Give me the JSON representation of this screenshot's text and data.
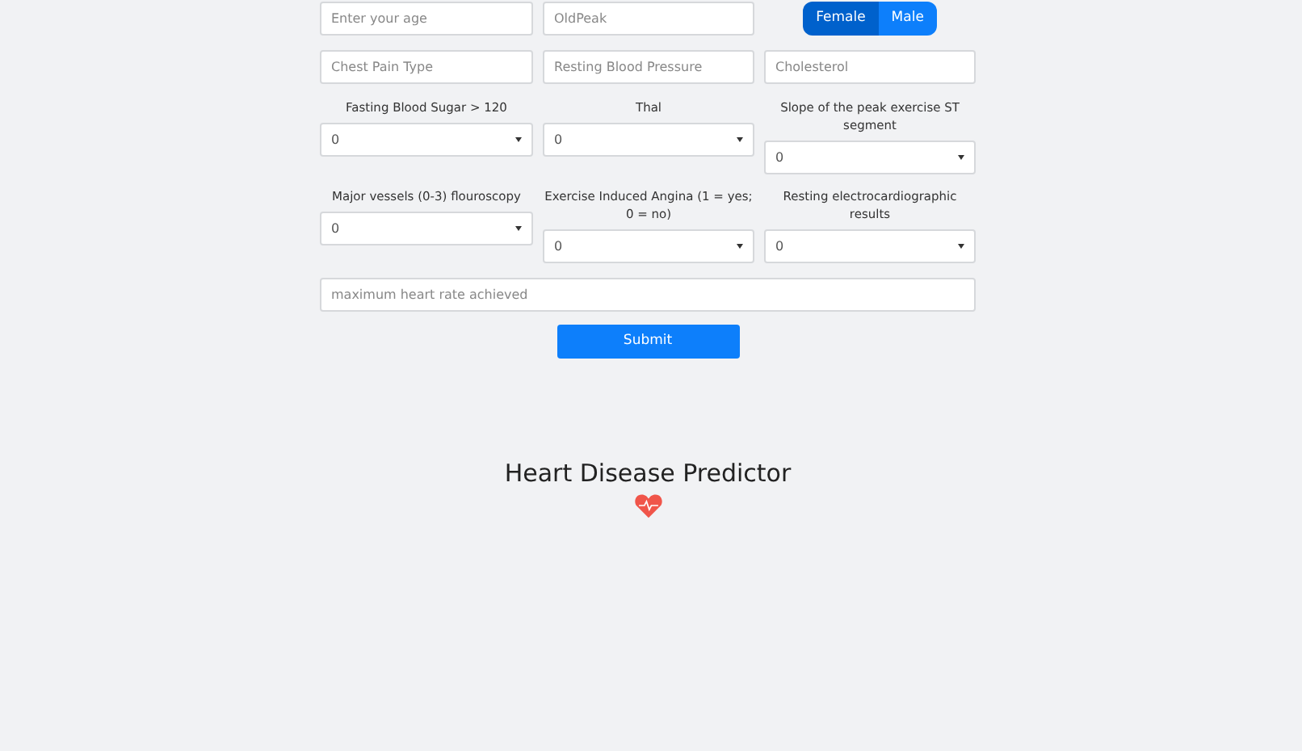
{
  "top_fields": [
    {
      "placeholder": "Enter your age"
    },
    {
      "placeholder": "OldPeak"
    }
  ],
  "gender": [
    {
      "label": "Female",
      "selected": true
    },
    {
      "label": "Male",
      "selected": false
    }
  ],
  "second_fields": [
    {
      "placeholder": "Chest Pain Type"
    },
    {
      "placeholder": "Resting Blood Pressure"
    },
    {
      "placeholder": "Cholesterol"
    }
  ],
  "selects": [
    {
      "label": "Fasting Blood Sugar > 120",
      "value": "0"
    },
    {
      "label": "Thal",
      "value": "0"
    },
    {
      "label": "Slope of the peak exercise ST segment",
      "value": "0"
    },
    {
      "label": "Major vessels (0-3) flouroscopy",
      "value": "0"
    },
    {
      "label": "Exercise Induced Angina (1 = yes; 0 = no)",
      "value": "0"
    },
    {
      "label": "Resting electrocardiographic results",
      "value": "0"
    }
  ],
  "max_heart_rate": {
    "placeholder": "maximum heart rate achieved"
  },
  "submit": "Submit",
  "title": "Heart Disease Predictor"
}
